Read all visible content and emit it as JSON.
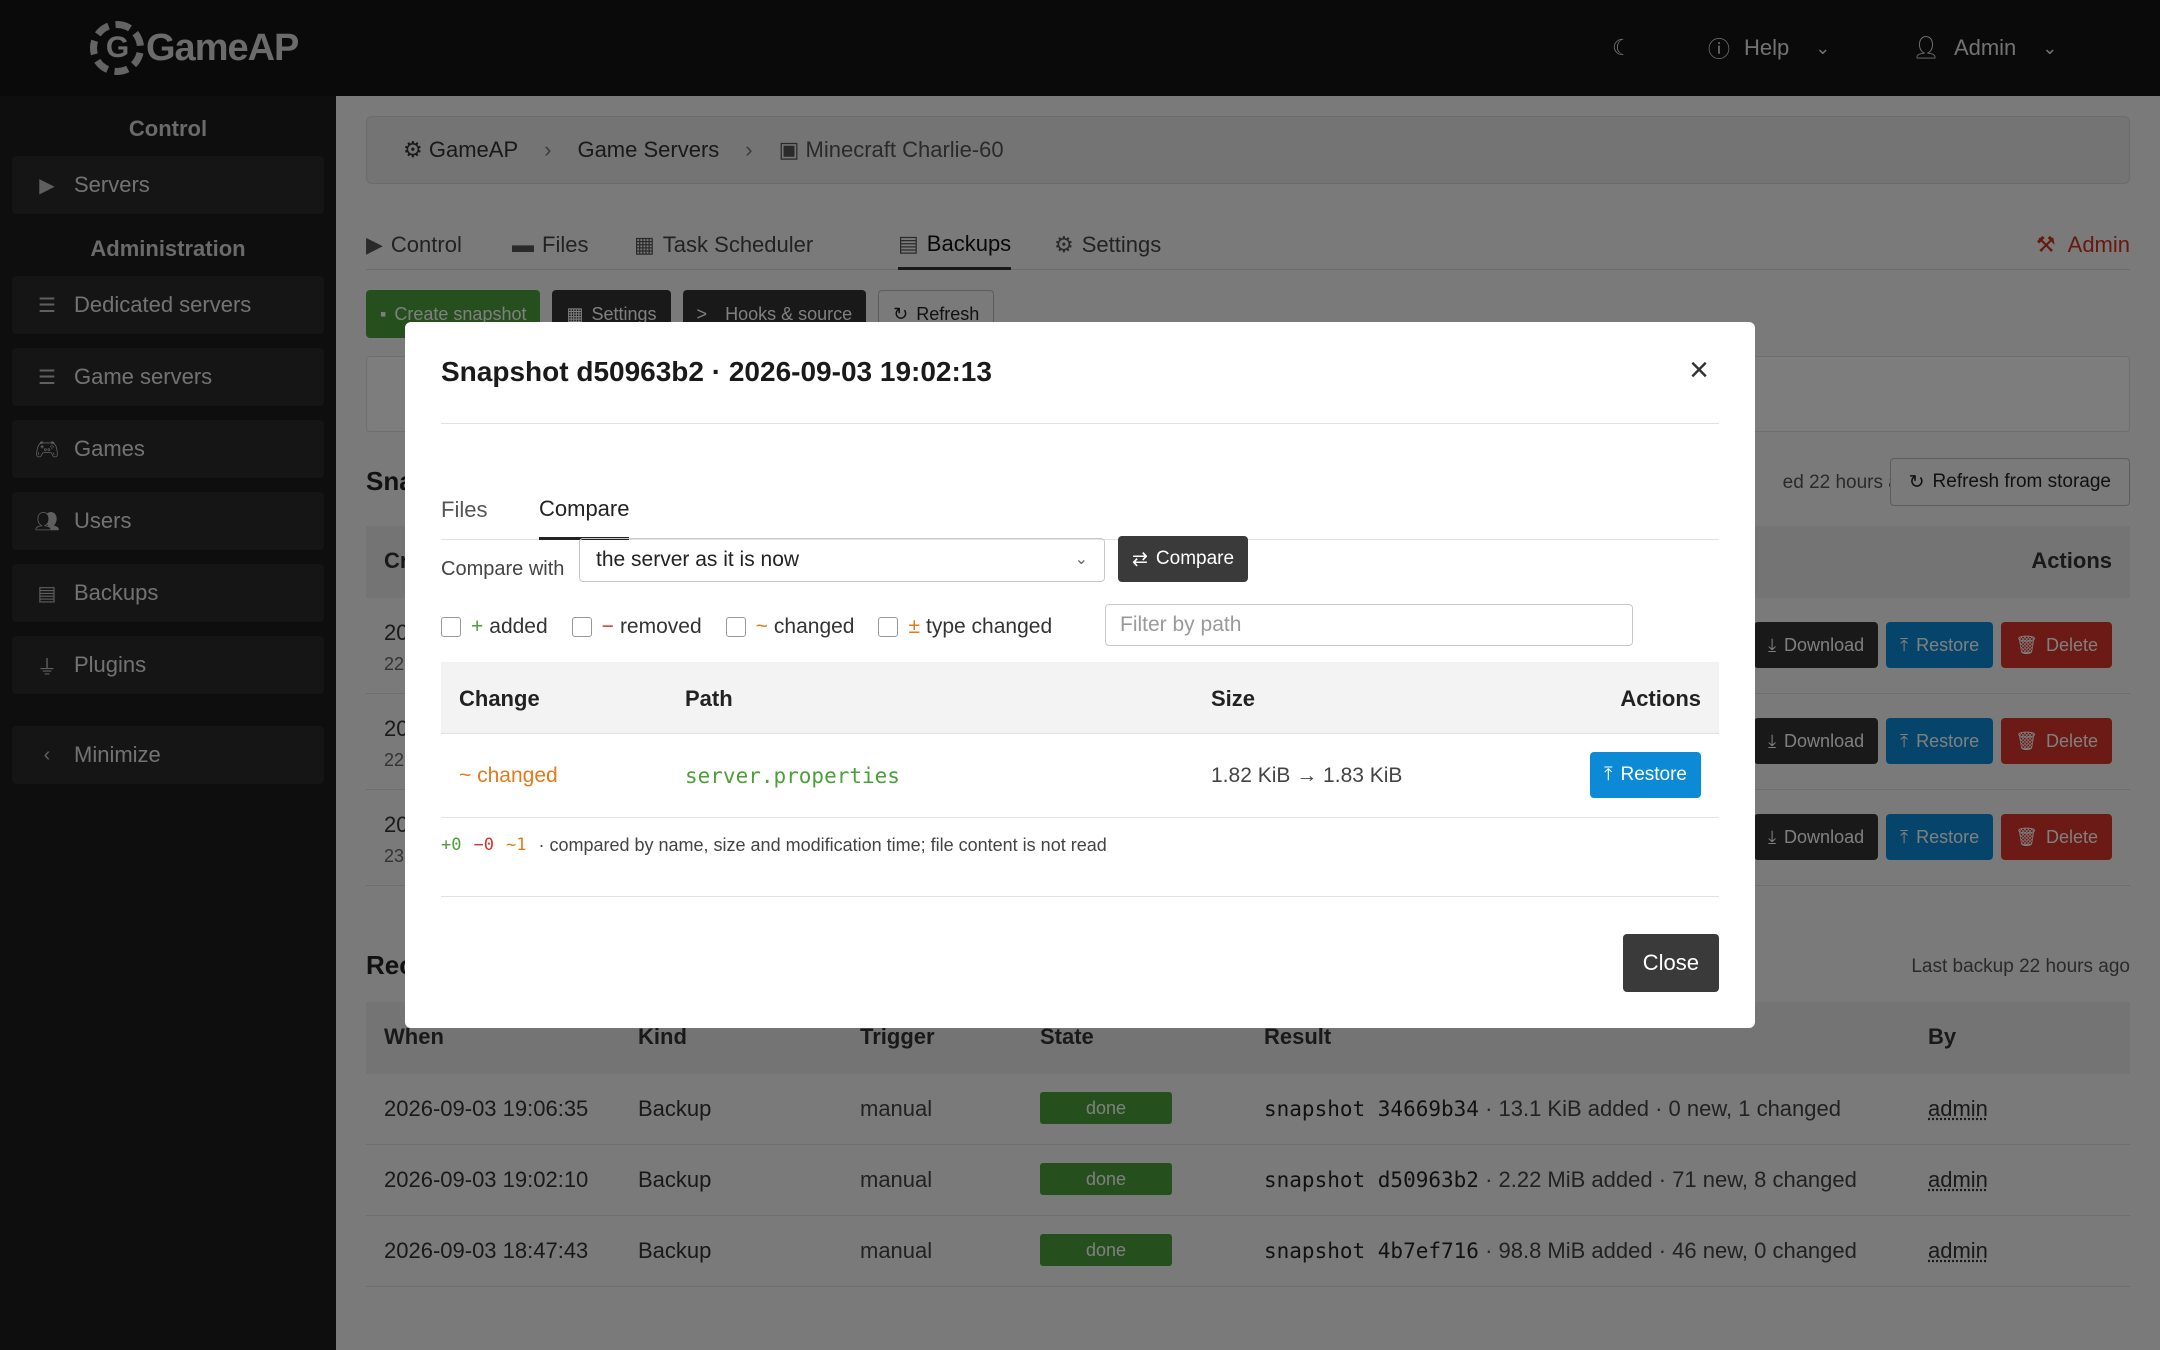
{
  "topbar": {
    "logo_text": "GameAP",
    "logo_mark": "G",
    "theme_icon": "moon-icon",
    "help_label": "Help",
    "user_label": "Admin"
  },
  "sidebar": {
    "section_control": "Control",
    "section_admin": "Administration",
    "items": [
      {
        "label": "Servers",
        "icon": "play-icon"
      },
      {
        "label": "Dedicated servers",
        "icon": "server-icon"
      },
      {
        "label": "Game servers",
        "icon": "server-icon"
      },
      {
        "label": "Games",
        "icon": "gamepad-icon"
      },
      {
        "label": "Users",
        "icon": "users-icon"
      },
      {
        "label": "Backups",
        "icon": "file-archive-icon"
      },
      {
        "label": "Plugins",
        "icon": "plug-icon"
      }
    ],
    "minimize_label": "Minimize"
  },
  "breadcrumb": {
    "items": [
      "GameAP",
      "Game Servers",
      "Minecraft Charlie-60"
    ]
  },
  "tabs": {
    "items": [
      "Control",
      "Files",
      "Task Scheduler",
      "Backups",
      "Settings"
    ],
    "active": "Backups",
    "admin_label": "Admin"
  },
  "toolbar": {
    "create_snapshot": "Create snapshot",
    "settings": "Settings",
    "hooks": "Hooks & source",
    "refresh": "Refresh"
  },
  "snapshots": {
    "title_visible": "Sna",
    "updated_visible": "ed 22 hours ago",
    "refresh_storage": "Refresh from storage",
    "header_created_visible": "Cr",
    "header_actions": "Actions",
    "rows": [
      {
        "date_visible": "20",
        "sub_visible": "22"
      },
      {
        "date_visible": "20",
        "sub_visible": "22"
      },
      {
        "date_visible": "20",
        "sub_visible": "23"
      }
    ],
    "download_label": "Download",
    "restore_label": "Restore",
    "delete_label": "Delete"
  },
  "recent": {
    "title_visible": "Rec",
    "last_backup": "Last backup 22 hours ago",
    "columns": [
      "When",
      "Kind",
      "Trigger",
      "State",
      "Result",
      "By"
    ],
    "rows": [
      {
        "when": "2026-09-03 19:06:35",
        "kind": "Backup",
        "trigger": "manual",
        "state": "done",
        "snapshot": "snapshot 34669b34",
        "result": "· 13.1 KiB added · 0 new, 1 changed",
        "by": "admin"
      },
      {
        "when": "2026-09-03 19:02:10",
        "kind": "Backup",
        "trigger": "manual",
        "state": "done",
        "snapshot": "snapshot d50963b2",
        "result": "· 2.22 MiB added · 71 new, 8 changed",
        "by": "admin"
      },
      {
        "when": "2026-09-03 18:47:43",
        "kind": "Backup",
        "trigger": "manual",
        "state": "done",
        "snapshot": "snapshot 4b7ef716",
        "result": "· 98.8 MiB added · 46 new, 0 changed",
        "by": "admin"
      }
    ]
  },
  "modal": {
    "title": "Snapshot d50963b2 · 2026-09-03 19:02:13",
    "tabs": [
      "Files",
      "Compare"
    ],
    "active_tab": "Compare",
    "compare_with_label": "Compare with",
    "compare_select_value": "the server as it is now",
    "compare_button": "Compare",
    "filters": [
      {
        "symbol": "+",
        "label": "added"
      },
      {
        "symbol": "−",
        "label": "removed"
      },
      {
        "symbol": "~",
        "label": "changed"
      },
      {
        "symbol": "±",
        "label": "type changed"
      }
    ],
    "path_filter_placeholder": "Filter by path",
    "columns": [
      "Change",
      "Path",
      "Size",
      "Actions"
    ],
    "rows": [
      {
        "change": "~ changed",
        "path": "server.properties",
        "size": "1.82 KiB → 1.83 KiB",
        "action": "Restore"
      }
    ],
    "summary_added": "+0",
    "summary_removed": "−0",
    "summary_changed": "~1",
    "summary_note": "· compared by name, size and modification time; file content is not read",
    "close_label": "Close"
  },
  "colors": {
    "green": "#4ba03a",
    "blue": "#0d8ad6",
    "red": "#d9352b",
    "orange": "#e37a1a",
    "dark": "#3a3a3a"
  }
}
